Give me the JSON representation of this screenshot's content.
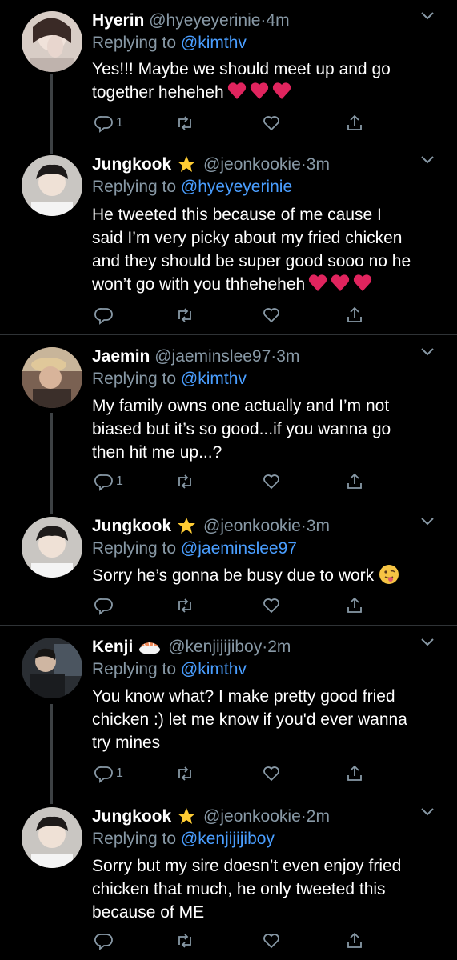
{
  "tweets": [
    {
      "name": "Hyerin",
      "handle": "@hyeyeyerinie",
      "sep": "·",
      "time": "4m",
      "reply_prefix": "Replying to",
      "reply_to": "@kimthv",
      "lines": [
        "Yes!!! Maybe we should meet up and go",
        "together heheheh"
      ],
      "reply_count": "1"
    },
    {
      "name": "Jungkook",
      "handle": "@jeonkookie",
      "sep": "·",
      "time": "3m",
      "reply_prefix": "Replying to",
      "reply_to": "@hyeyeyerinie",
      "lines": [
        "He tweeted this because of me cause I",
        "said I’m very picky about my fried chicken",
        "and they should be super good sooo no he",
        "won’t go with you thheheheh"
      ],
      "reply_count": ""
    },
    {
      "name": "Jaemin",
      "handle": "@jaeminslee97",
      "sep": "·",
      "time": "3m",
      "reply_prefix": "Replying to",
      "reply_to": "@kimthv",
      "lines": [
        "My family owns one actually and I’m not",
        "biased but it’s so good...if you wanna go",
        "then hit me up...?"
      ],
      "reply_count": "1"
    },
    {
      "name": "Jungkook",
      "handle": "@jeonkookie",
      "sep": "·",
      "time": "3m",
      "reply_prefix": "Replying to",
      "reply_to": "@jaeminslee97",
      "lines": [
        "Sorry he’s gonna be busy due to work"
      ],
      "reply_count": ""
    },
    {
      "name": "Kenji",
      "handle": "@kenjijijiboy",
      "sep": "·",
      "time": "2m",
      "reply_prefix": "Replying to",
      "reply_to": "@kimthv",
      "lines": [
        "You know what? I make pretty good fried",
        "chicken :) let me know if you'd ever wanna",
        "try mines"
      ],
      "reply_count": "1"
    },
    {
      "name": "Jungkook",
      "handle": "@jeonkookie",
      "sep": "·",
      "time": "2m",
      "reply_prefix": "Replying to",
      "reply_to": "@kenjijijiboy",
      "lines": [
        "Sorry but my sire doesn’t even enjoy fried",
        "chicken that much, he only tweeted this",
        "because of ME"
      ],
      "reply_count": ""
    }
  ],
  "colors": {
    "background": "#000000",
    "muted": "#8899a6",
    "link": "#4a9eff",
    "heart_emoji": "#e0245e",
    "thread_line": "#3d4144"
  },
  "icons": {
    "reply": "reply-icon",
    "retweet": "retweet-icon",
    "like": "like-icon",
    "share": "share-icon",
    "menu": "chevron-down-icon",
    "badge_jungkook": "star-emoji",
    "badge_kenji": "sushi-emoji",
    "end_emoji_jungkook_2": "smiling-face-tongue-emoji"
  }
}
